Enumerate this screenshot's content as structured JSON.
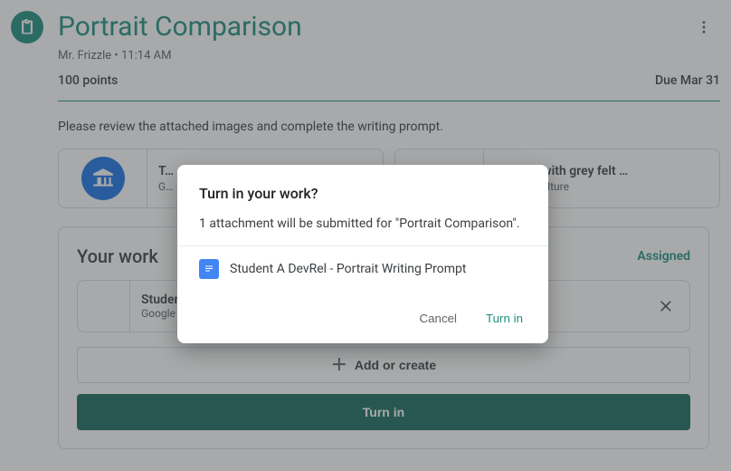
{
  "header": {
    "title": "Portrait Comparison",
    "teacher": "Mr. Frizzle",
    "time": "11:14 AM",
    "byline": "Mr. Frizzle • 11:14 AM",
    "points": "100 points",
    "due": "Due Mar 31"
  },
  "description": "Please review the attached images and complete the writing prompt.",
  "attachments": [
    {
      "title": "T…",
      "source": "G…"
    },
    {
      "title": "…ortrait with grey felt …",
      "source": "…Arts & Culture"
    }
  ],
  "work": {
    "heading": "Your work",
    "status": "Assigned",
    "item": {
      "title": "Studen…",
      "subtitle": "Google …"
    },
    "add_label": "Add or create",
    "turnin_label": "Turn in"
  },
  "dialog": {
    "title": "Turn in your work?",
    "body": "1 attachment will be submitted for \"Portrait Comparison\".",
    "attachment": "Student A DevRel - Portrait Writing Prompt",
    "cancel": "Cancel",
    "turnin": "Turn in"
  },
  "colors": {
    "accent": "#1e8e7e",
    "blue": "#1a73e8"
  }
}
